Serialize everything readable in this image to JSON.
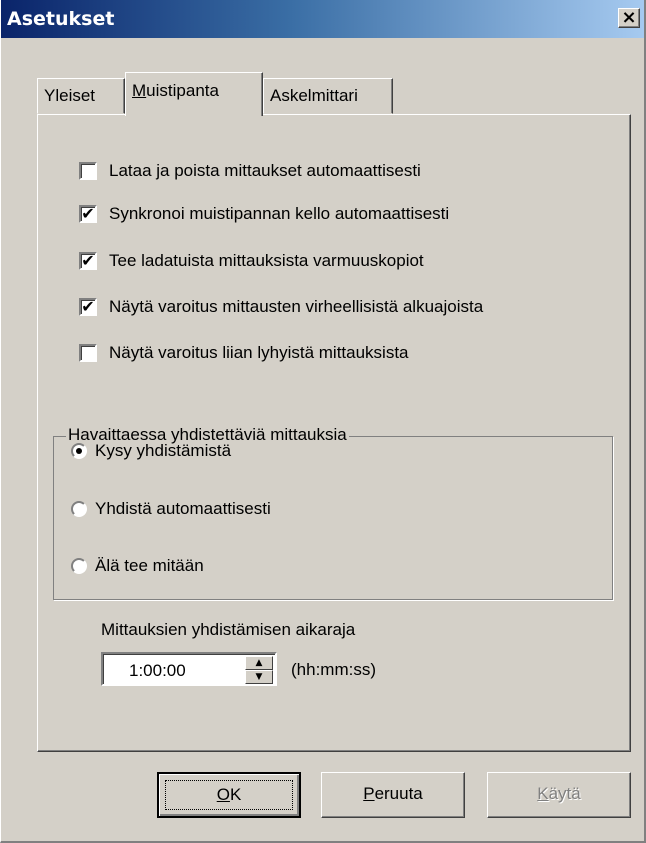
{
  "window": {
    "title": "Asetukset",
    "close_glyph": "×"
  },
  "tabs": [
    {
      "label": "Yleiset",
      "active": false
    },
    {
      "label_pre": "",
      "label_u": "M",
      "label_post": "uistipanta",
      "active": true
    },
    {
      "label": "Askelmittari",
      "active": false
    }
  ],
  "options": [
    {
      "label": "Lataa ja poista mittaukset automaattisesti",
      "checked": false
    },
    {
      "label": "Synkronoi muistipannan kello automaattisesti",
      "checked": true
    },
    {
      "label": "Tee ladatuista mittauksista varmuuskopiot",
      "checked": true
    },
    {
      "label": "Näytä varoitus mittausten virheellisistä alkuajoista",
      "checked": true
    },
    {
      "label": "Näytä varoitus liian lyhyistä mittauksista",
      "checked": false
    }
  ],
  "merge_group": {
    "label": "Havaittaessa yhdistettäviä mittauksia",
    "choices": [
      {
        "label": "Kysy yhdistämistä",
        "selected": true
      },
      {
        "label": "Yhdistä automaattisesti",
        "selected": false
      },
      {
        "label": "Älä tee mitään",
        "selected": false
      }
    ]
  },
  "time_limit": {
    "label": "Mittauksien yhdistämisen aikaraja",
    "value": "1:00:00",
    "unit": "(hh:mm:ss)"
  },
  "buttons": {
    "ok_u": "O",
    "ok_rest": "K",
    "cancel_u": "P",
    "cancel_rest": "eruuta",
    "apply_u": "K",
    "apply_rest": "äytä"
  },
  "icons": {
    "check": "✔",
    "spin_up": "▲",
    "spin_down": "▼"
  }
}
